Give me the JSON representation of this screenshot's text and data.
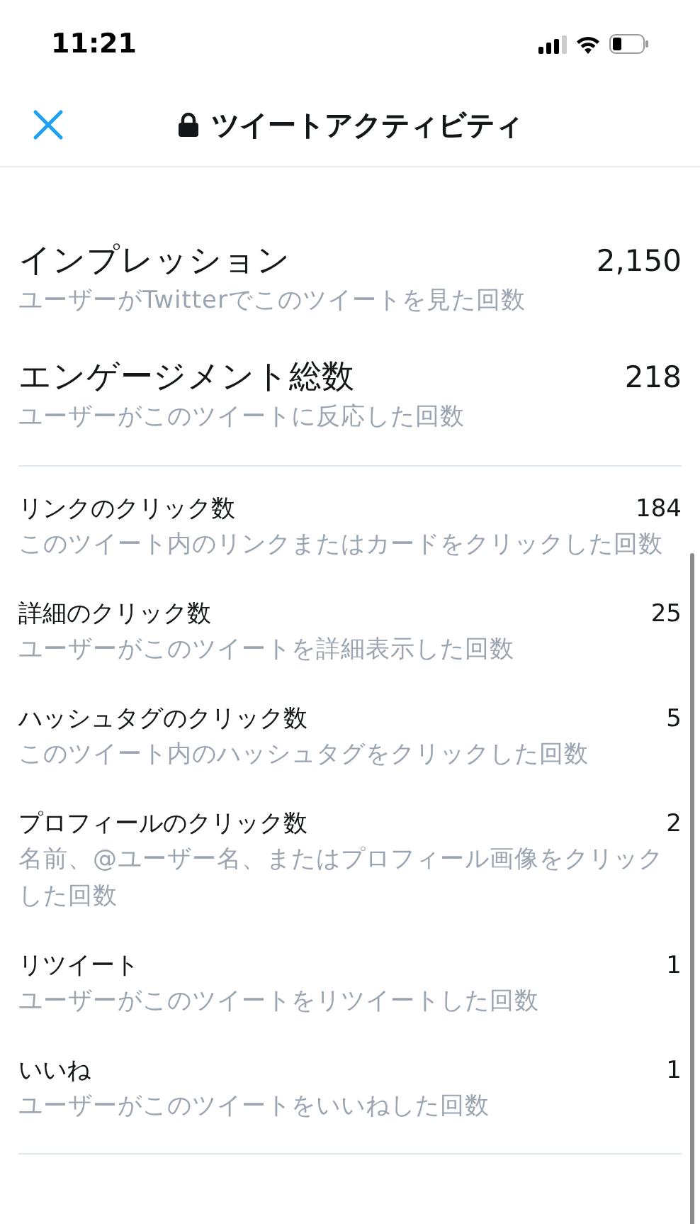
{
  "status_bar": {
    "time": "11:21"
  },
  "header": {
    "title": "ツイートアクティビティ"
  },
  "primary_metrics": [
    {
      "label": "インプレッション",
      "value": "2,150",
      "description": "ユーザーがTwitterでこのツイートを見た回数"
    },
    {
      "label": "エンゲージメント総数",
      "value": "218",
      "description": "ユーザーがこのツイートに反応した回数"
    }
  ],
  "engagement_metrics": [
    {
      "label": "リンクのクリック数",
      "value": "184",
      "description": "このツイート内のリンクまたはカードをクリックした回数"
    },
    {
      "label": "詳細のクリック数",
      "value": "25",
      "description": "ユーザーがこのツイートを詳細表示した回数"
    },
    {
      "label": "ハッシュタグのクリック数",
      "value": "5",
      "description": "このツイート内のハッシュタグをクリックした回数"
    },
    {
      "label": "プロフィールのクリック数",
      "value": "2",
      "description": "名前、@ユーザー名、またはプロフィール画像をクリックした回数"
    },
    {
      "label": "リツイート",
      "value": "1",
      "description": "ユーザーがこのツイートをリツイートした回数"
    },
    {
      "label": "いいね",
      "value": "1",
      "description": "ユーザーがこのツイートをいいねした回数"
    }
  ]
}
